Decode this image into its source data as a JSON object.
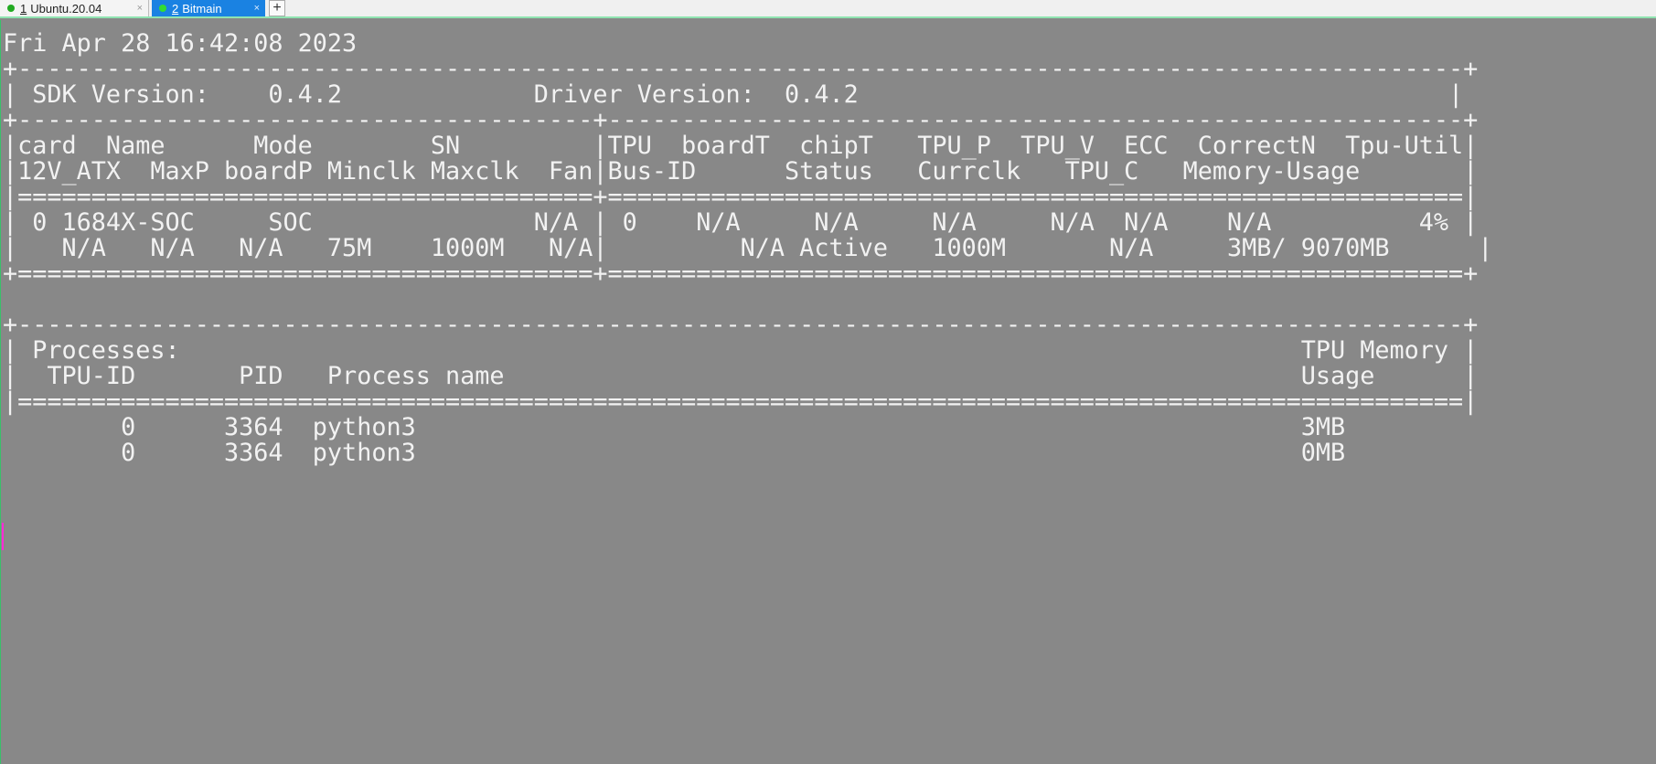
{
  "tabs": [
    {
      "number": "1",
      "label": "Ubuntu.20.04",
      "close": "×",
      "status_color": "#22aa22"
    },
    {
      "number": "2",
      "label": "Bitmain",
      "close": "×",
      "status_color": "#33dd33"
    }
  ],
  "new_tab_label": "+",
  "terminal": {
    "lines": [
      "Fri Apr 28 16:42:08 2023",
      "+--------------------------------------------------------------------------------------------------+",
      "| SDK Version:    0.4.2             Driver Version:  0.4.2                                        |",
      "+---------------------------------------+----------------------------------------------------------+",
      "|card  Name      Mode        SN         |TPU  boardT  chipT   TPU_P  TPU_V  ECC  CorrectN  Tpu-Util|",
      "|12V_ATX  MaxP boardP Minclk Maxclk  Fan|Bus-ID      Status   Currclk   TPU_C   Memory-Usage       |",
      "|=======================================+==========================================================|",
      "| 0 1684X-SOC     SOC               N/A | 0    N/A     N/A     N/A     N/A  N/A    N/A          4% |",
      "|   N/A   N/A   N/A   75M    1000M   N/A|         N/A Active   1000M       N/A     3MB/ 9070MB      |",
      "+=======================================+==========================================================+",
      "",
      "+--------------------------------------------------------------------------------------------------+",
      "| Processes:                                                                            TPU Memory |",
      "|  TPU-ID       PID   Process name                                                      Usage      |",
      "|==================================================================================================|",
      "        0      3364  python3                                                            3MB",
      "        0      3364  python3                                                            0MB"
    ]
  },
  "colors": {
    "terminal_background": "#888888",
    "terminal_text": "#f2f2f2",
    "active_tab": "#1a82e2",
    "separator": "#8fe3b0"
  }
}
